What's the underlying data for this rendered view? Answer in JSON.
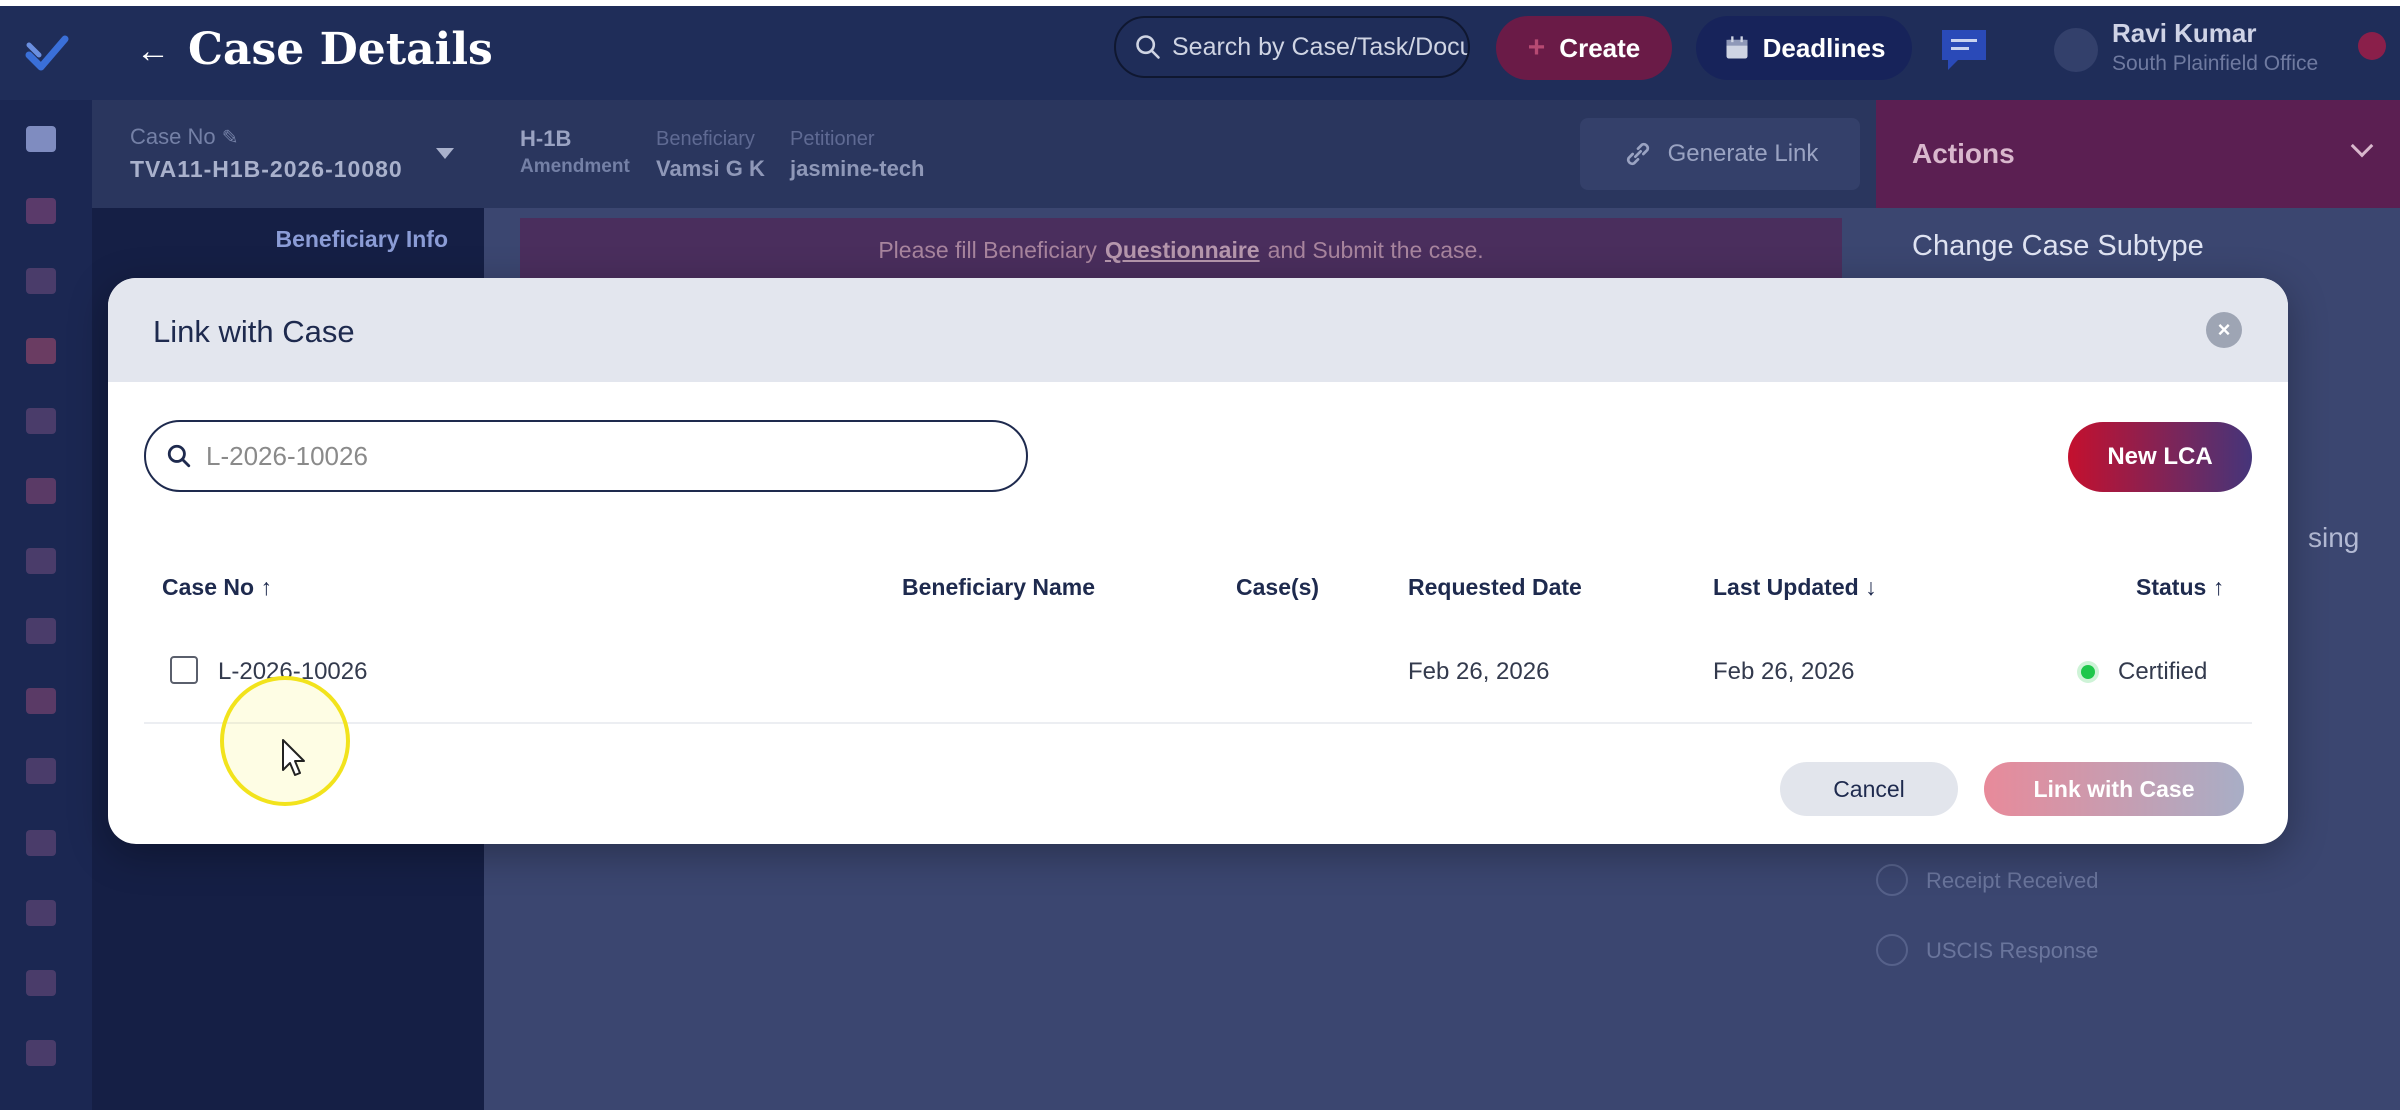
{
  "header": {
    "page_title": "Case Details",
    "search_placeholder": "Search by Case/Task/Docu",
    "create_label": "Create",
    "deadlines_label": "Deadlines",
    "user_name": "Ravi Kumar",
    "user_office": "South Plainfield Office"
  },
  "subheader": {
    "case_no_label": "Case No",
    "case_no_value": "TVA11-H1B-2026-10080",
    "case_type": "H-1B",
    "case_subtype": "Amendment",
    "beneficiary_label": "Beneficiary",
    "beneficiary_value": "Vamsi G K",
    "petitioner_label": "Petitioner",
    "petitioner_value": "jasmine-tech",
    "generate_link_label": "Generate Link"
  },
  "sidebar": {
    "section_title": "Beneficiary Info"
  },
  "banner": {
    "text_before": "Please fill Beneficiary",
    "link_text": "Questionnaire",
    "text_after": "and Submit the case."
  },
  "actions_panel": {
    "title": "Actions",
    "change_subtype": "Change Case Subtype",
    "partial_text": "sing",
    "timeline": [
      {
        "label": "Receipt Received"
      },
      {
        "label": "USCIS Response"
      }
    ]
  },
  "modal": {
    "title": "Link with Case",
    "search_value": "L-2026-10026",
    "new_lca_label": "New LCA",
    "columns": {
      "case_no": "Case No",
      "case_no_sort": "↑",
      "beneficiary_name": "Beneficiary Name",
      "cases": "Case(s)",
      "requested_date": "Requested Date",
      "last_updated": "Last Updated",
      "last_updated_sort": "↓",
      "status": "Status",
      "status_sort": "↑"
    },
    "rows": [
      {
        "case_no": "L-2026-10026",
        "beneficiary_name": "",
        "cases": "",
        "requested_date": "Feb 26, 2026",
        "last_updated": "Feb 26, 2026",
        "status": "Certified",
        "checked": false
      }
    ],
    "cancel_label": "Cancel",
    "link_label": "Link with Case"
  },
  "icons": {
    "logo": "check-logo-icon",
    "back": "arrow-left-icon",
    "search": "search-icon",
    "create": "plus-icon",
    "deadlines": "calendar-icon",
    "chat": "chat-icon",
    "edit": "pencil-icon",
    "link": "link-icon",
    "close": "close-icon",
    "status": "status-dot-icon",
    "cursor": "mouse-pointer-icon"
  },
  "colors": {
    "primary_navy": "#1e2a4e",
    "brand_red": "#c4102e",
    "status_green": "#1ec74b",
    "cursor_highlight": "#f2e31c"
  }
}
